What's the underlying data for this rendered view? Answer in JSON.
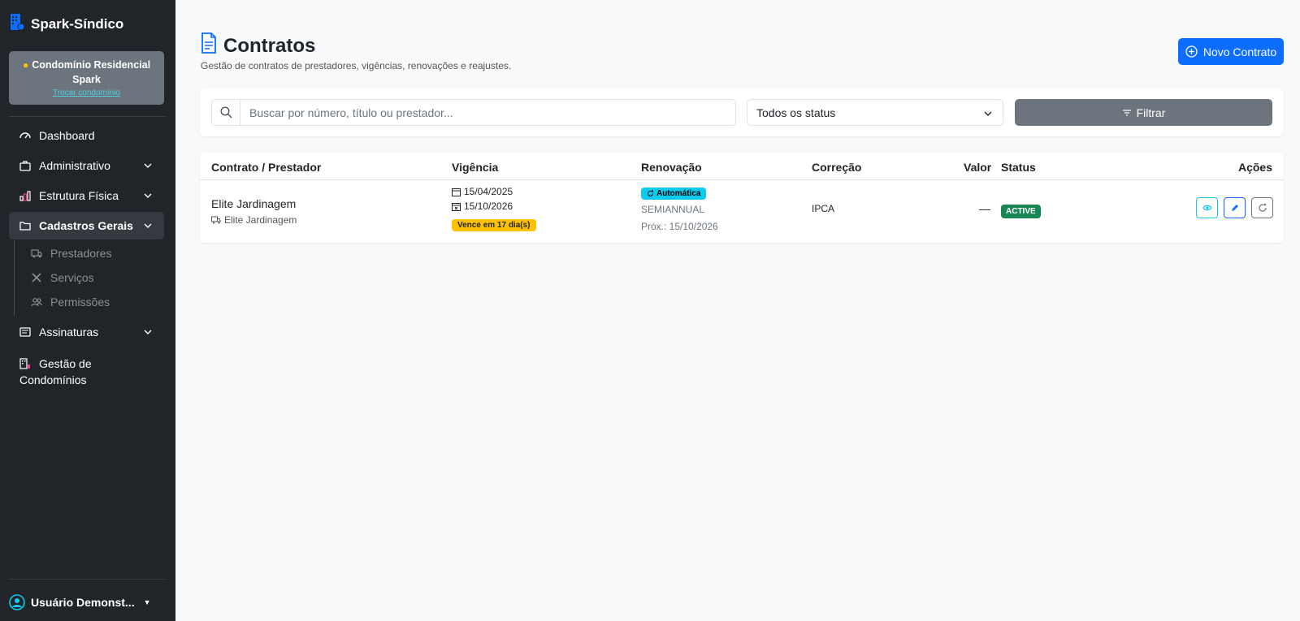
{
  "app": {
    "name": "Spark-Síndico"
  },
  "condo": {
    "name": "Condomínio Residencial Spark",
    "switch_label": "Trocar condomínio"
  },
  "sidebar": {
    "items": [
      {
        "label": "Dashboard",
        "icon": "speedometer-icon"
      },
      {
        "label": "Administrativo",
        "icon": "briefcase-icon"
      },
      {
        "label": "Estrutura Física",
        "icon": "building-chart-icon"
      },
      {
        "label": "Cadastros Gerais",
        "icon": "folder-icon"
      },
      {
        "label": "Assinaturas",
        "icon": "card-list-icon"
      },
      {
        "label": "Gestão de Condomínios",
        "icon": "buildings-icon"
      }
    ],
    "subitems": [
      {
        "label": "Prestadores",
        "icon": "truck-icon"
      },
      {
        "label": "Serviços",
        "icon": "tools-icon"
      },
      {
        "label": "Permissões",
        "icon": "people-icon"
      }
    ]
  },
  "user": {
    "name": "Usuário Demonst..."
  },
  "page": {
    "title": "Contratos",
    "subtitle": "Gestão de contratos de prestadores, vigências, renovações e reajustes.",
    "new_button": "Novo Contrato"
  },
  "filters": {
    "search_placeholder": "Buscar por número, título ou prestador...",
    "status_selected": "Todos os status",
    "filter_button": "Filtrar"
  },
  "table": {
    "headers": [
      "Contrato / Prestador",
      "Vigência",
      "Renovação",
      "Correção",
      "Valor",
      "Status",
      "Ações"
    ],
    "rows": [
      {
        "title": "Elite Jardinagem",
        "provider": "Elite Jardinagem",
        "start": "15/04/2025",
        "end": "15/10/2026",
        "expiry_badge": "Vence em 17 dia(s)",
        "renewal_badge": "Automática",
        "renewal_period": "SEMIANNUAL",
        "next_renewal": "Próx.: 15/10/2026",
        "correction": "IPCA",
        "value": "—",
        "status": "ACTIVE"
      }
    ]
  },
  "colors": {
    "primary": "#0d6efd",
    "sidebar": "#212529",
    "info": "#0dcaf0",
    "warning": "#ffc107",
    "success": "#198754",
    "secondary": "#6c757d"
  }
}
